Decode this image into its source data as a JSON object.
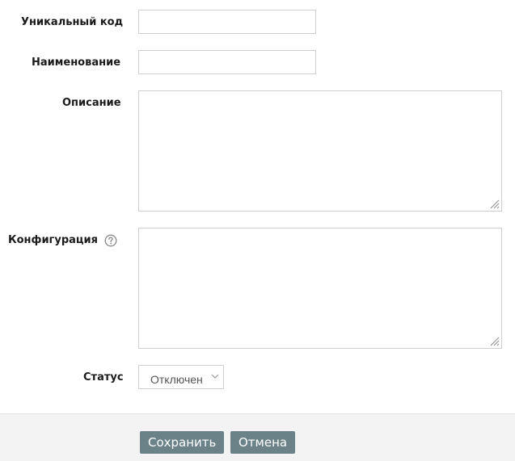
{
  "form": {
    "code": {
      "label": "Уникальный код",
      "value": ""
    },
    "name": {
      "label": "Наименование",
      "value": ""
    },
    "description": {
      "label": "Описание",
      "value": ""
    },
    "configuration": {
      "label": "Конфигурация",
      "value": "",
      "help_icon": "question-circle-icon"
    },
    "status": {
      "label": "Статус",
      "selected": "Отключен",
      "icon": "chevron-down-icon"
    }
  },
  "footer": {
    "save_label": "Сохранить",
    "cancel_label": "Отмена"
  },
  "colors": {
    "button_bg": "#6c8289",
    "footer_bg": "#f3f3f3",
    "input_border": "#cfcfcf"
  }
}
